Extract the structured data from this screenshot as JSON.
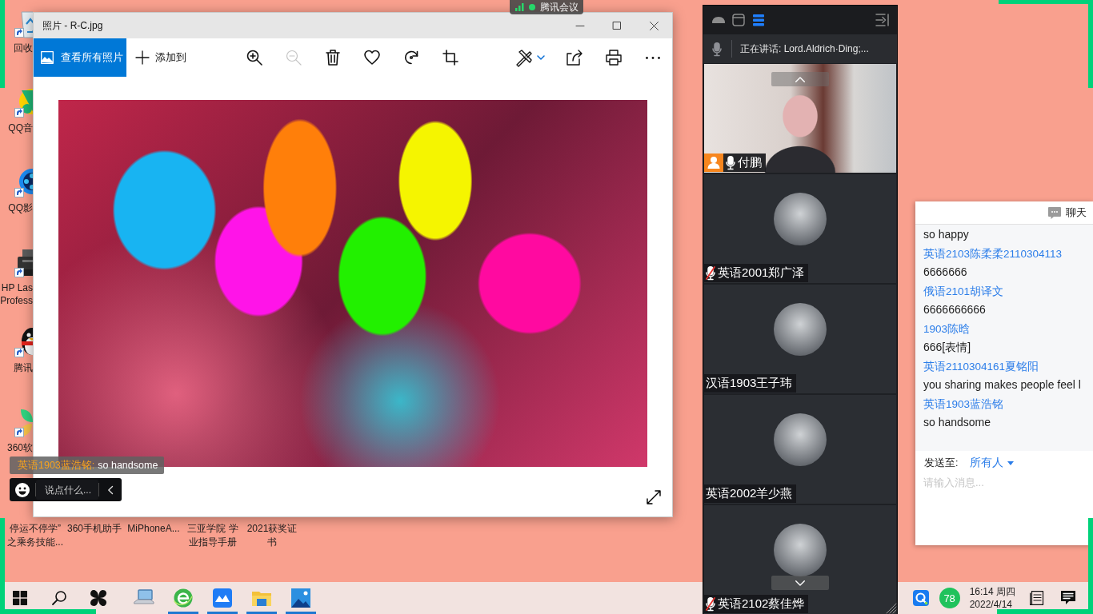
{
  "desktop": {
    "side_icons": [
      {
        "kind": "recycle_bin",
        "lines": [
          "回收"
        ]
      },
      {
        "kind": "music_app",
        "lines": [
          "QQ音"
        ]
      },
      {
        "kind": "video_app",
        "lines": [
          "QQ影"
        ]
      },
      {
        "kind": "printer",
        "lines": [
          "HP Las",
          "Profess"
        ]
      },
      {
        "kind": "penguin",
        "lines": [
          "腾讯"
        ]
      },
      {
        "kind": "leaf_app",
        "lines": [
          "360软"
        ]
      }
    ],
    "bottom_labels": [
      {
        "lines": [
          "停运不停学”",
          "之乘务技能..."
        ]
      },
      {
        "lines": [
          "360手机助手"
        ]
      },
      {
        "lines": [
          "MiPhoneA..."
        ]
      },
      {
        "lines": [
          "三亚学院 学",
          "业指导手册"
        ]
      },
      {
        "lines": [
          "2021获奖证",
          "书"
        ]
      }
    ]
  },
  "meeting_badge": {
    "label": "腾讯会议"
  },
  "photos_window": {
    "title": "照片 - R-C.jpg",
    "view_all": "查看所有照片",
    "add_to": "添加到",
    "tools": [
      {
        "kind": "zoom_in",
        "disabled": false
      },
      {
        "kind": "zoom_out",
        "disabled": true
      },
      {
        "kind": "delete",
        "disabled": false
      },
      {
        "kind": "favorite",
        "disabled": false
      },
      {
        "kind": "rotate",
        "disabled": false
      },
      {
        "kind": "crop",
        "disabled": false
      }
    ],
    "actions": [
      {
        "kind": "edit"
      },
      {
        "kind": "share"
      },
      {
        "kind": "print"
      },
      {
        "kind": "more"
      }
    ]
  },
  "danmaku": {
    "sender": "英语1903蓝浩铭:",
    "message": "so handsome",
    "placeholder": "说点什么..."
  },
  "meeting_panel": {
    "view_modes": [
      {
        "kind": "compact",
        "selected": false
      },
      {
        "kind": "window",
        "selected": false
      },
      {
        "kind": "list",
        "selected": true
      }
    ],
    "speaking": "正在讲话: Lord.Aldrich·Ding;...",
    "participants": [
      {
        "name": "付鹏",
        "kind": "video",
        "mic": true,
        "muted": false,
        "host": true
      },
      {
        "name": "英语2001郑广泽",
        "kind": "avatar",
        "mic": true,
        "muted": true,
        "host": false
      },
      {
        "name": "汉语1903王子玮",
        "kind": "avatar",
        "mic": false,
        "host": false
      },
      {
        "name": "英语2002羊少燕",
        "kind": "avatar",
        "mic": false,
        "host": false
      },
      {
        "name": "英语2102蔡佳烨",
        "kind": "avatar",
        "mic": true,
        "muted": true,
        "host": false
      }
    ]
  },
  "chat": {
    "title": "聊天",
    "messages": [
      {
        "kind": "text",
        "text": "so happy"
      },
      {
        "kind": "sender",
        "text": "英语2103陈柔柔2110304113"
      },
      {
        "kind": "text",
        "text": "6666666"
      },
      {
        "kind": "sender",
        "text": "俄语2101胡译文"
      },
      {
        "kind": "text",
        "text": "6666666666"
      },
      {
        "kind": "sender",
        "text": "1903陈晗"
      },
      {
        "kind": "text",
        "text": "666[表情]"
      },
      {
        "kind": "sender",
        "text": "英语2110304161夏铭阳"
      },
      {
        "kind": "text",
        "text": "you sharing makes people feel l"
      },
      {
        "kind": "sender",
        "text": "英语1903蓝浩铭"
      },
      {
        "kind": "text",
        "text": "so handsome"
      }
    ],
    "send_to_label": "发送至:",
    "recipient": "所有人",
    "placeholder": "请输入消息..."
  },
  "taskbar": {
    "system_buttons": [
      {
        "kind": "start"
      },
      {
        "kind": "search"
      }
    ],
    "apps": [
      {
        "kind": "pinwheel",
        "running": false
      },
      {
        "kind": "computer",
        "running": false
      },
      {
        "kind": "browser",
        "running": true
      },
      {
        "kind": "cloud",
        "running": true
      },
      {
        "kind": "folder",
        "running": true
      },
      {
        "kind": "photos",
        "running": true
      }
    ],
    "tray": {
      "badge": "78",
      "time": "16:14 周四",
      "date": "2022/4/14"
    }
  }
}
